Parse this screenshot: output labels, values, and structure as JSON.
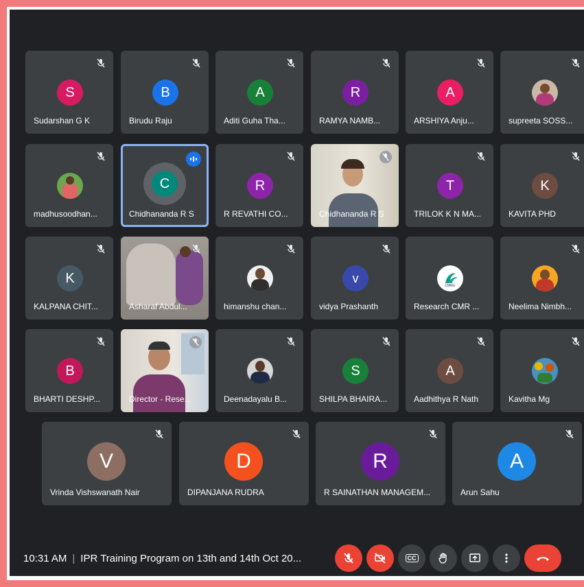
{
  "meeting": {
    "time": "10:31 AM",
    "title": "IPR Training Program on 13th and 14th Oct 20..."
  },
  "participants": {
    "r1": [
      {
        "name": "Sudarshan G K",
        "initial": "S",
        "color": "#d81b60"
      },
      {
        "name": "Birudu Raju",
        "initial": "B",
        "color": "#1a73e8"
      },
      {
        "name": "Aditi Guha Tha...",
        "initial": "A",
        "color": "#188038"
      },
      {
        "name": "RAMYA NAMB...",
        "initial": "R",
        "color": "#7b1fa2"
      },
      {
        "name": "ARSHIYA Anju...",
        "initial": "A",
        "color": "#e91e63"
      },
      {
        "name": "supreeta SOSS..."
      }
    ],
    "r2": [
      {
        "name": "madhusoodhan..."
      },
      {
        "name": "Chidhananda R S",
        "initial": "C",
        "color": "#00897b"
      },
      {
        "name": "R REVATHI CO...",
        "initial": "R",
        "color": "#8e24aa"
      },
      {
        "name": "Chidhananda R S"
      },
      {
        "name": "TRILOK K N MA...",
        "initial": "T",
        "color": "#8e24aa"
      },
      {
        "name": "KAVITA PHD",
        "initial": "K",
        "color": "#6d4c41"
      }
    ],
    "r3": [
      {
        "name": "KALPANA CHIT...",
        "initial": "K",
        "color": "#455a64"
      },
      {
        "name": "Asharaf Abdul..."
      },
      {
        "name": "himanshu chan..."
      },
      {
        "name": "vidya Prashanth",
        "initial": "v",
        "color": "#3949ab"
      },
      {
        "name": "Research CMR ...",
        "logo": "CMRU"
      },
      {
        "name": "Neelima Nimbh..."
      }
    ],
    "r4": [
      {
        "name": "BHARTI DESHP...",
        "initial": "B",
        "color": "#c2185b"
      },
      {
        "name": "Director - Rese..."
      },
      {
        "name": "Deenadayalu B..."
      },
      {
        "name": "SHILPA BHAIRA...",
        "initial": "S",
        "color": "#188038"
      },
      {
        "name": "Aadhithya R Nath",
        "initial": "A",
        "color": "#6d4c41"
      },
      {
        "name": "Kavitha Mg"
      }
    ],
    "r5": [
      {
        "name": "Vrinda Vishswanath Nair",
        "initial": "V",
        "color": "#8d6e63"
      },
      {
        "name": "DIPANJANA RUDRA",
        "initial": "D",
        "color": "#f4511e"
      },
      {
        "name": "R SAINATHAN MANAGEM...",
        "initial": "R",
        "color": "#6a1b9a"
      },
      {
        "name": "Arun Sahu",
        "initial": "A",
        "color": "#1e88e5"
      }
    ]
  },
  "controls": {
    "mic": "mic-off-icon",
    "camera": "camera-off-icon",
    "captions": "CC",
    "hand": "raise-hand-icon",
    "present": "present-icon",
    "more": "more-options-icon",
    "end": "end-call-icon"
  }
}
